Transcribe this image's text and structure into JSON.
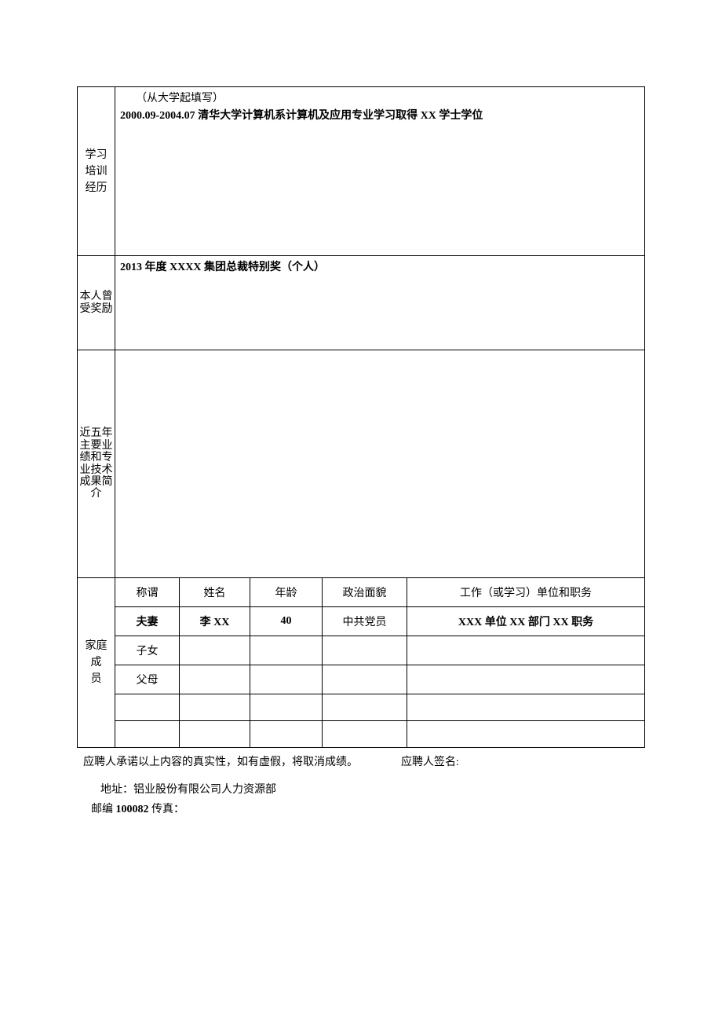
{
  "sections": {
    "education": {
      "label_line1": "学习",
      "label_line2": "培训",
      "label_line3": "经历",
      "note": "（从大学起填写）",
      "entry": "2000.09-2004.07 清华大学计算机系计算机及应用专业学习取得 XX 学士学位"
    },
    "award": {
      "label": "本人曾受奖励",
      "entry": "2013 年度 XXXX 集团总裁特别奖（个人）"
    },
    "achievement": {
      "label": "近五年主要业绩和专业技术成果简介",
      "entry": ""
    },
    "family": {
      "label_line1": "家庭成",
      "label_line2": "员",
      "headers": {
        "relation": "称谓",
        "name": "姓名",
        "age": "年龄",
        "political": "政治面貌",
        "work": "工作（或学习）单位和职务"
      },
      "rows": [
        {
          "relation": "夫妻",
          "name": "李 XX",
          "age": "40",
          "political": "中共党员",
          "work": "XXX 单位 XX 部门 XX 职务"
        },
        {
          "relation": "子女",
          "name": "",
          "age": "",
          "political": "",
          "work": ""
        },
        {
          "relation": "父母",
          "name": "",
          "age": "",
          "political": "",
          "work": ""
        },
        {
          "relation": "",
          "name": "",
          "age": "",
          "political": "",
          "work": ""
        },
        {
          "relation": "",
          "name": "",
          "age": "",
          "political": "",
          "work": ""
        }
      ]
    }
  },
  "footer": {
    "promise": "应聘人承诺以上内容的真实性，如有虚假，将取消成绩。",
    "signature_label": "应聘人签名:",
    "address": "地址：铝业股份有限公司人力资源部",
    "postal_prefix": "邮编",
    "postal_code": "100082",
    "fax_label": "传真："
  }
}
